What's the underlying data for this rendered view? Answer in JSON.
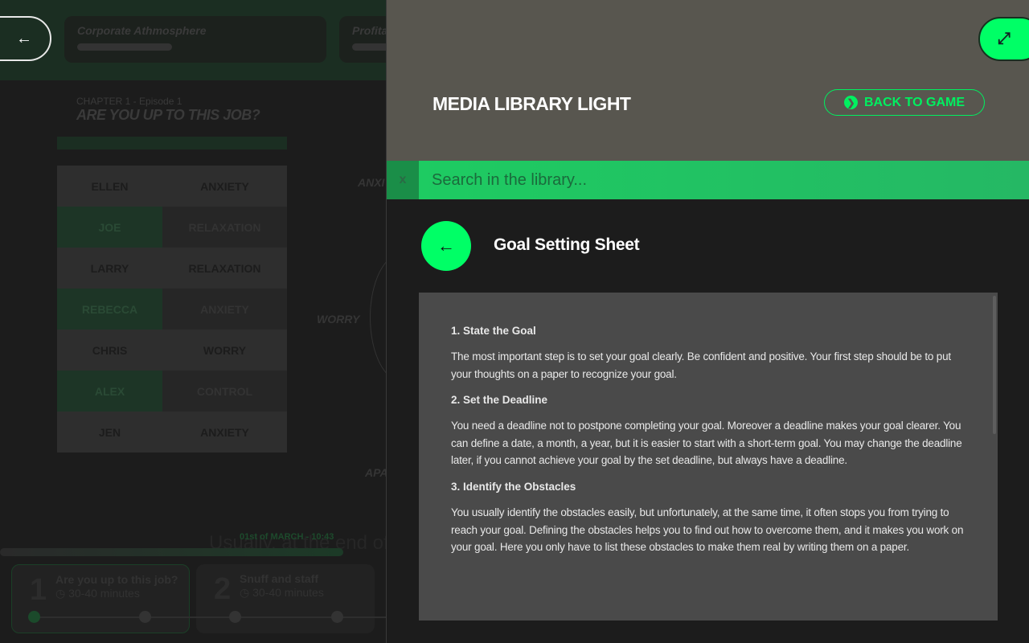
{
  "game": {
    "back_icon": "arrow-left",
    "stats": [
      {
        "label": "Corporate Athmosphere",
        "fill": 0.45
      },
      {
        "label": "Profita",
        "fill": 0.3
      }
    ],
    "chapter": "CHAPTER 1 - Episode 1",
    "title": "ARE YOU UP TO THIS JOB?",
    "people": [
      {
        "name": "ELLEN",
        "state": "ANXIETY"
      },
      {
        "name": "JOE",
        "state": "RELAXATION"
      },
      {
        "name": "LARRY",
        "state": "RELAXATION"
      },
      {
        "name": "REBECCA",
        "state": "ANXIETY"
      },
      {
        "name": "CHRIS",
        "state": "WORRY"
      },
      {
        "name": "ALEX",
        "state": "CONTROL"
      },
      {
        "name": "JEN",
        "state": "ANXIETY"
      }
    ],
    "emotions": {
      "top": "ANXI",
      "left": "WORRY",
      "bottom": "APA"
    },
    "date": "01st of MARCH - 10:43",
    "background_text": "Usually, at the end of y",
    "timeline_progress": 0.9,
    "episodes": [
      {
        "num": "1",
        "name": "Are you up to this job?",
        "duration": "30-40 minutes"
      },
      {
        "num": "2",
        "name": "Snuff and staff",
        "duration": "30-40 minutes"
      }
    ]
  },
  "panel": {
    "title": "MEDIA LIBRARY LIGHT",
    "back_to_game": "BACK TO GAME",
    "expand_icon": "expand-arrows",
    "search_clear": "x",
    "search_placeholder": "Search in the library...",
    "search_value": "",
    "doc_title": "Goal Setting Sheet",
    "sections": [
      {
        "heading": "1. State the Goal",
        "body": "The most important step is to set your goal clearly. Be confident and positive. Your first step should be to put your thoughts on a paper to recognize your goal."
      },
      {
        "heading": "2. Set the Deadline",
        "body": "You need a deadline not to postpone completing your goal. Moreover a deadline makes your goal clearer. You can define a date, a month, a year, but it is easier to start with a short-term goal. You may change the deadline later, if you cannot achieve your goal by the set deadline, but always have a deadline."
      },
      {
        "heading": "3. Identify the Obstacles",
        "body": "You usually identify the obstacles easily, but unfortunately, at the same time, it often stops you from trying to reach your goal. Defining the obstacles helps you to find out how to overcome them, and it makes you work on your goal. Here you only have to list these obstacles to make them real by writing them on a paper."
      }
    ]
  },
  "colors": {
    "accent": "#00ff66",
    "header": "#58564f",
    "doc_bg": "#4a4a4a"
  }
}
